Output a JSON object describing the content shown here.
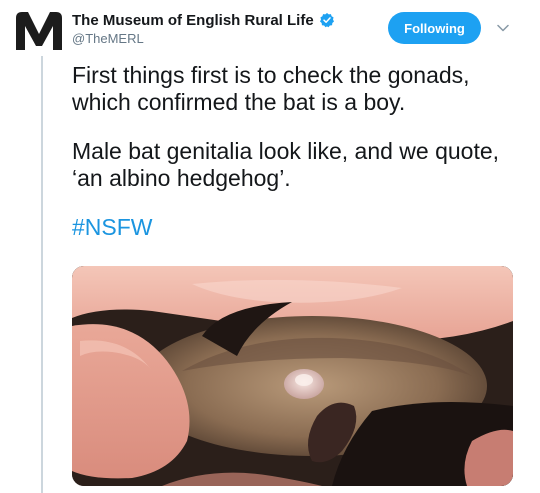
{
  "account": {
    "display_name": "The Museum of English Rural Life",
    "handle": "@TheMERL",
    "avatar_icon": "merl-m-logo-icon",
    "verified_icon": "verified-badge-icon"
  },
  "actions": {
    "follow_label": "Following",
    "more_icon": "chevron-down-icon"
  },
  "tweet": {
    "paragraphs": [
      "First things first is to check the gonads, which confirmed the bat is a boy.",
      "Male bat genitalia look like, and we quote, ‘an albino hedgehog’."
    ],
    "hashtag": "#NSFW"
  },
  "media": {
    "icon": "bat-photo-image"
  },
  "colors": {
    "accent": "#1da1f2",
    "hashtag": "#1b95e0",
    "handle_gray": "#657786",
    "thread_line": "#ccd6dd"
  }
}
